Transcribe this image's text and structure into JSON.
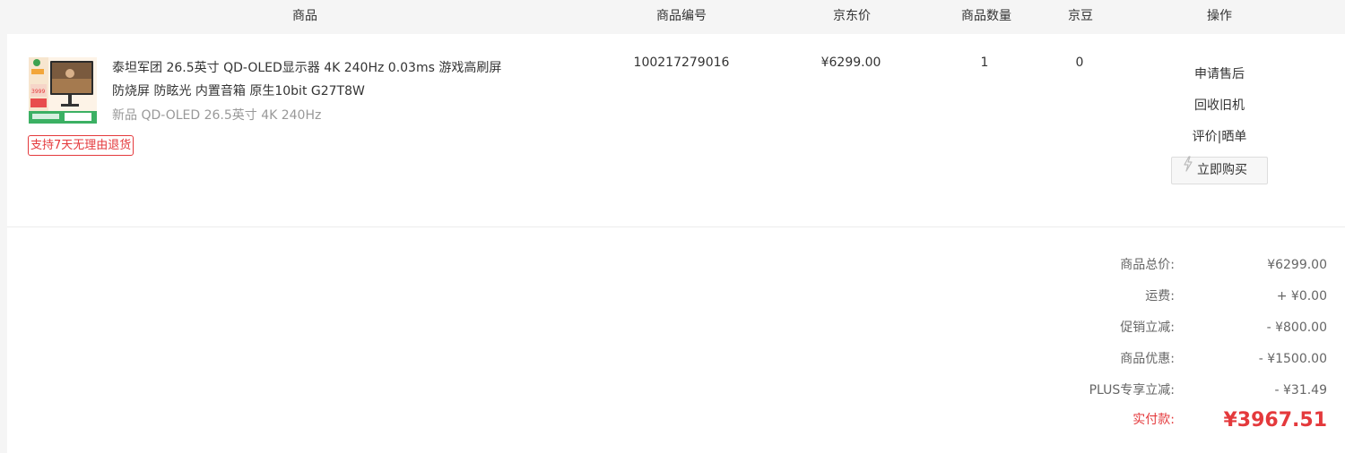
{
  "header": {
    "product": "商品",
    "sku": "商品编号",
    "price": "京东价",
    "quantity": "商品数量",
    "jingdou": "京豆",
    "actions": "操作"
  },
  "item": {
    "name": "泰坦军团 26.5英寸 QD-OLED显示器 4K 240Hz 0.03ms 游戏高刷屏 防烧屏 防眩光 内置音箱 原生10bit G27T8W",
    "spec": "新品 QD-OLED 26.5英寸 4K 240Hz",
    "badge": "支持7天无理由退货",
    "sku": "100217279016",
    "price": "¥6299.00",
    "quantity": "1",
    "jingdou": "0",
    "thumb_price": "3999"
  },
  "actions": {
    "after_sale": "申请售后",
    "recycle": "回收旧机",
    "review": "评价|晒单",
    "buy_now": "立即购买"
  },
  "summary": [
    {
      "label": "商品总价:",
      "value": "¥6299.00"
    },
    {
      "label": "运费:",
      "value": "+ ¥0.00"
    },
    {
      "label": "促销立减:",
      "value": "- ¥800.00"
    },
    {
      "label": "商品优惠:",
      "value": "- ¥1500.00"
    },
    {
      "label": "PLUS专享立减:",
      "value": "- ¥31.49"
    },
    {
      "label": "实付款:",
      "value": "¥3967.51"
    }
  ],
  "colors": {
    "accent_red": "#e4393c",
    "header_bg": "#f5f5f5",
    "muted_text": "#999999"
  }
}
